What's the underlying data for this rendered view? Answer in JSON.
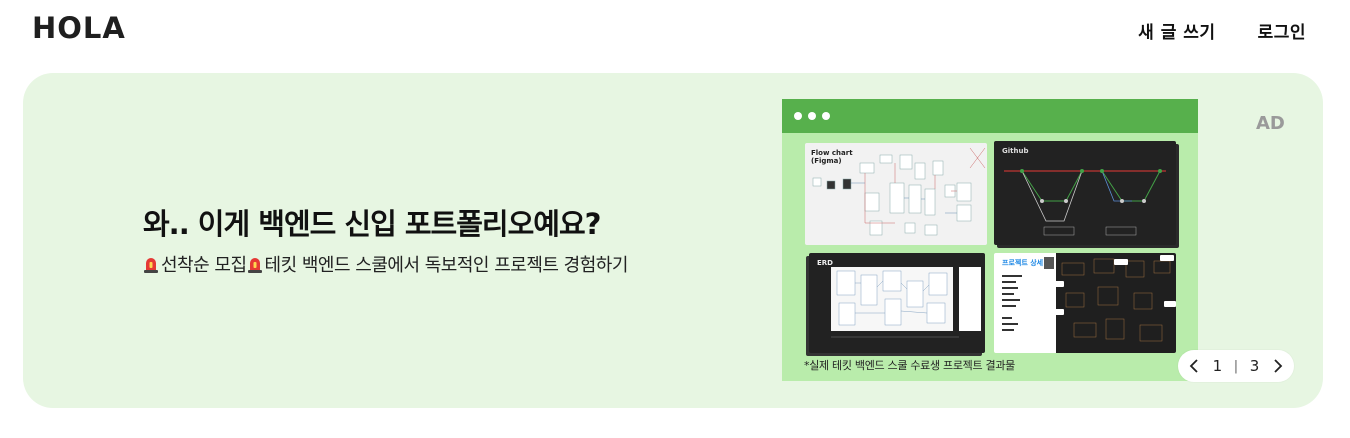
{
  "header": {
    "logo_text": "HOLA",
    "nav": {
      "write_label": "새 글 쓰기",
      "login_label": "로그인"
    }
  },
  "banner": {
    "headline": "와.. 이게 백엔드 신입 포트폴리오예요?",
    "subline_part1": "선착순 모집",
    "subline_part2": " 테킷 백엔드 스쿨에서 독보적인 프로젝트 경험하기",
    "ad_label": "AD",
    "image": {
      "panels": {
        "flow_title_1": "Flow chart",
        "flow_title_2": "(Figma)",
        "git_title": "Github",
        "erd_title": "ERD",
        "proj_title": "프로젝트 상세"
      },
      "caption": "*실제 테킷 백엔드 스쿨 수료생 프로젝트 결과물"
    },
    "pager": {
      "current": "1",
      "separator": "|",
      "total": "3"
    }
  },
  "colors": {
    "banner_bg": "#e7f6e2",
    "window_bar": "#57b04c",
    "window_bg": "#b9ecab",
    "ad_label": "#9a9a9a",
    "logo_accent": "#f5a623"
  },
  "icons": {
    "logo_mark": "pencil-icon",
    "siren": "siren-icon",
    "prev": "chevron-left-icon",
    "next": "chevron-right-icon"
  }
}
